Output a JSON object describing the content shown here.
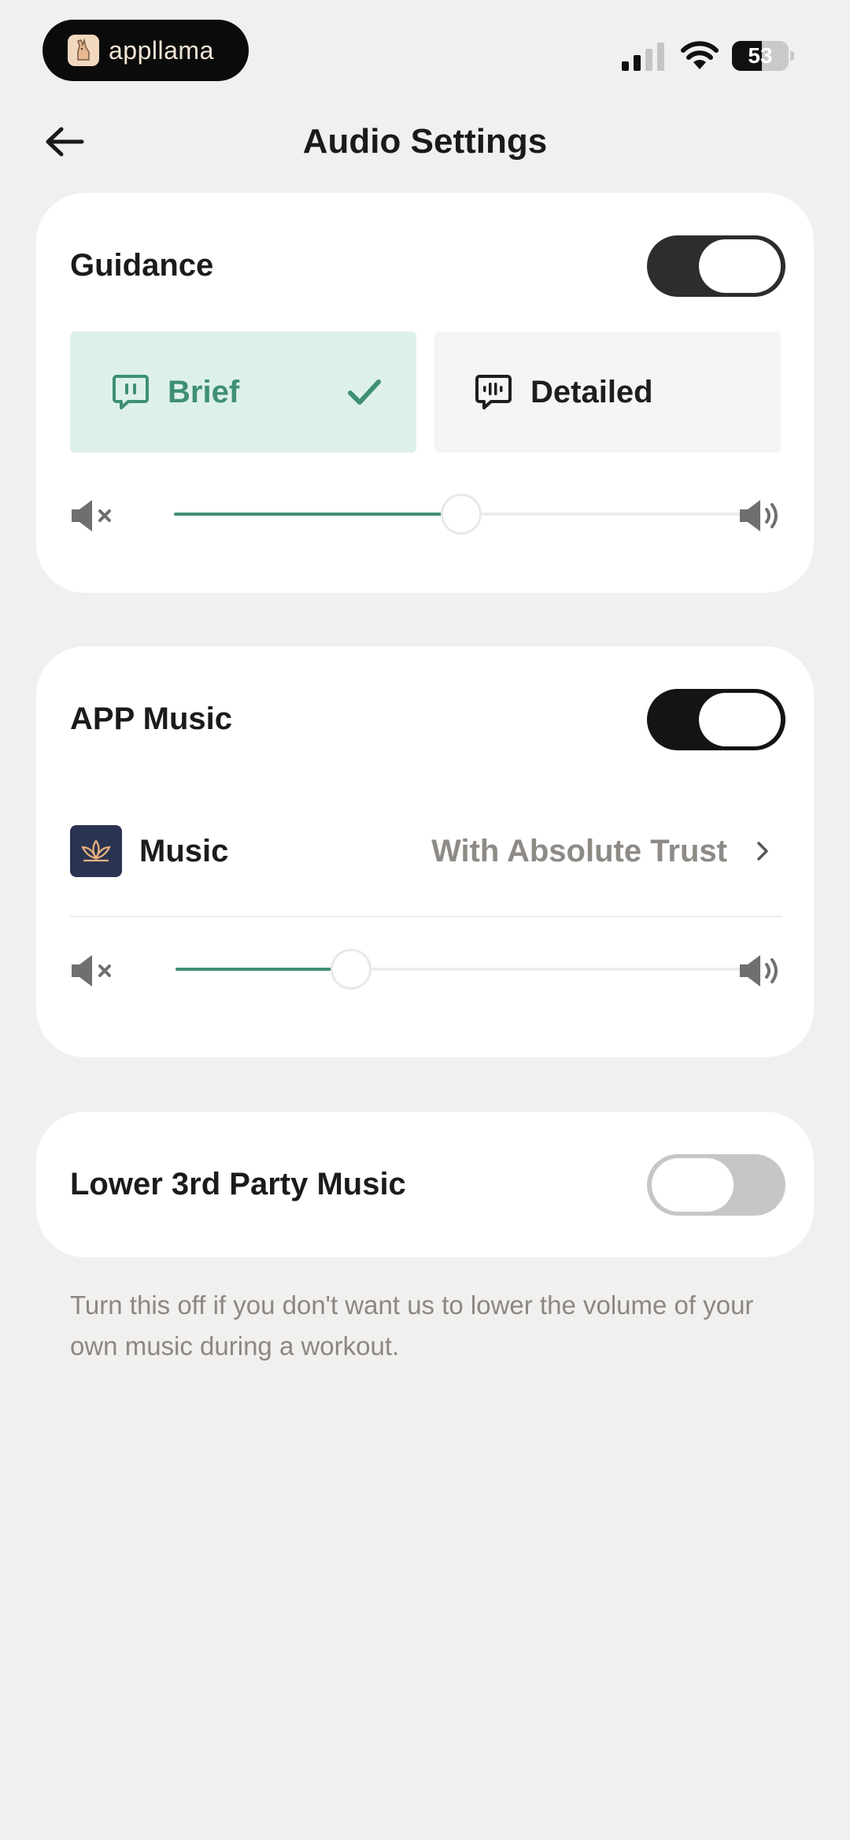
{
  "status_bar": {
    "app_name": "appllama",
    "battery": "53",
    "battery_level": 0.53
  },
  "header": {
    "title": "Audio Settings"
  },
  "guidance": {
    "title": "Guidance",
    "enabled": true,
    "modes": [
      {
        "label": "Brief",
        "selected": true
      },
      {
        "label": "Detailed",
        "selected": false
      }
    ],
    "volume": 0.5
  },
  "app_music": {
    "title": "APP Music",
    "enabled": true,
    "music_label": "Music",
    "music_value": "With Absolute Trust",
    "volume": 0.31
  },
  "third_party": {
    "title": "Lower 3rd Party Music",
    "enabled": false,
    "note": "Turn this off if you don't want us to lower the volume of your own music during a workout."
  },
  "colors": {
    "accent": "#3f8f74",
    "selected_bg": "#ddf1ea",
    "background": "#f1f0ee"
  }
}
